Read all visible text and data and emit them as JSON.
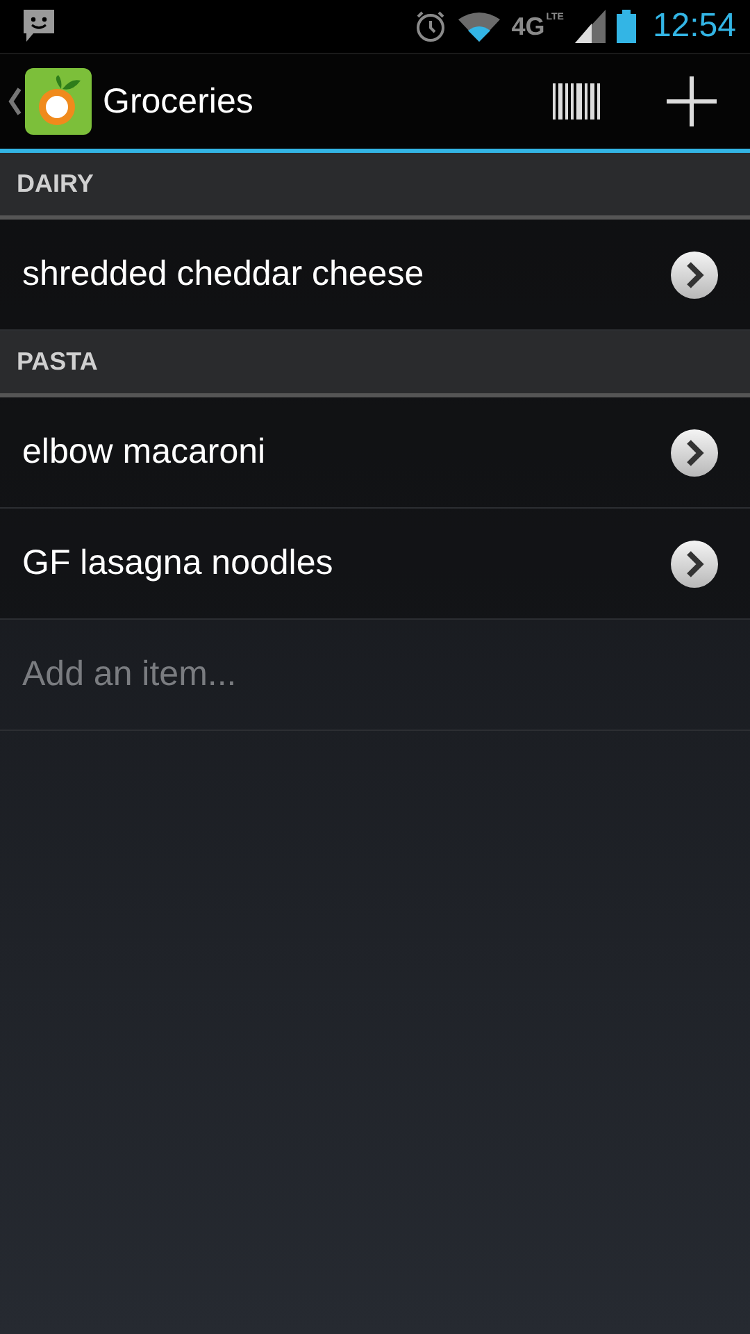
{
  "status_bar": {
    "network": "4G",
    "network_sub": "LTE",
    "time": "12:54"
  },
  "action_bar": {
    "title": "Groceries"
  },
  "sections": [
    {
      "header": "DAIRY",
      "items": [
        {
          "name": "shredded cheddar cheese"
        }
      ]
    },
    {
      "header": "PASTA",
      "items": [
        {
          "name": "elbow macaroni"
        },
        {
          "name": "GF lasagna noodles"
        }
      ]
    }
  ],
  "add_item": {
    "placeholder": "Add an item..."
  }
}
